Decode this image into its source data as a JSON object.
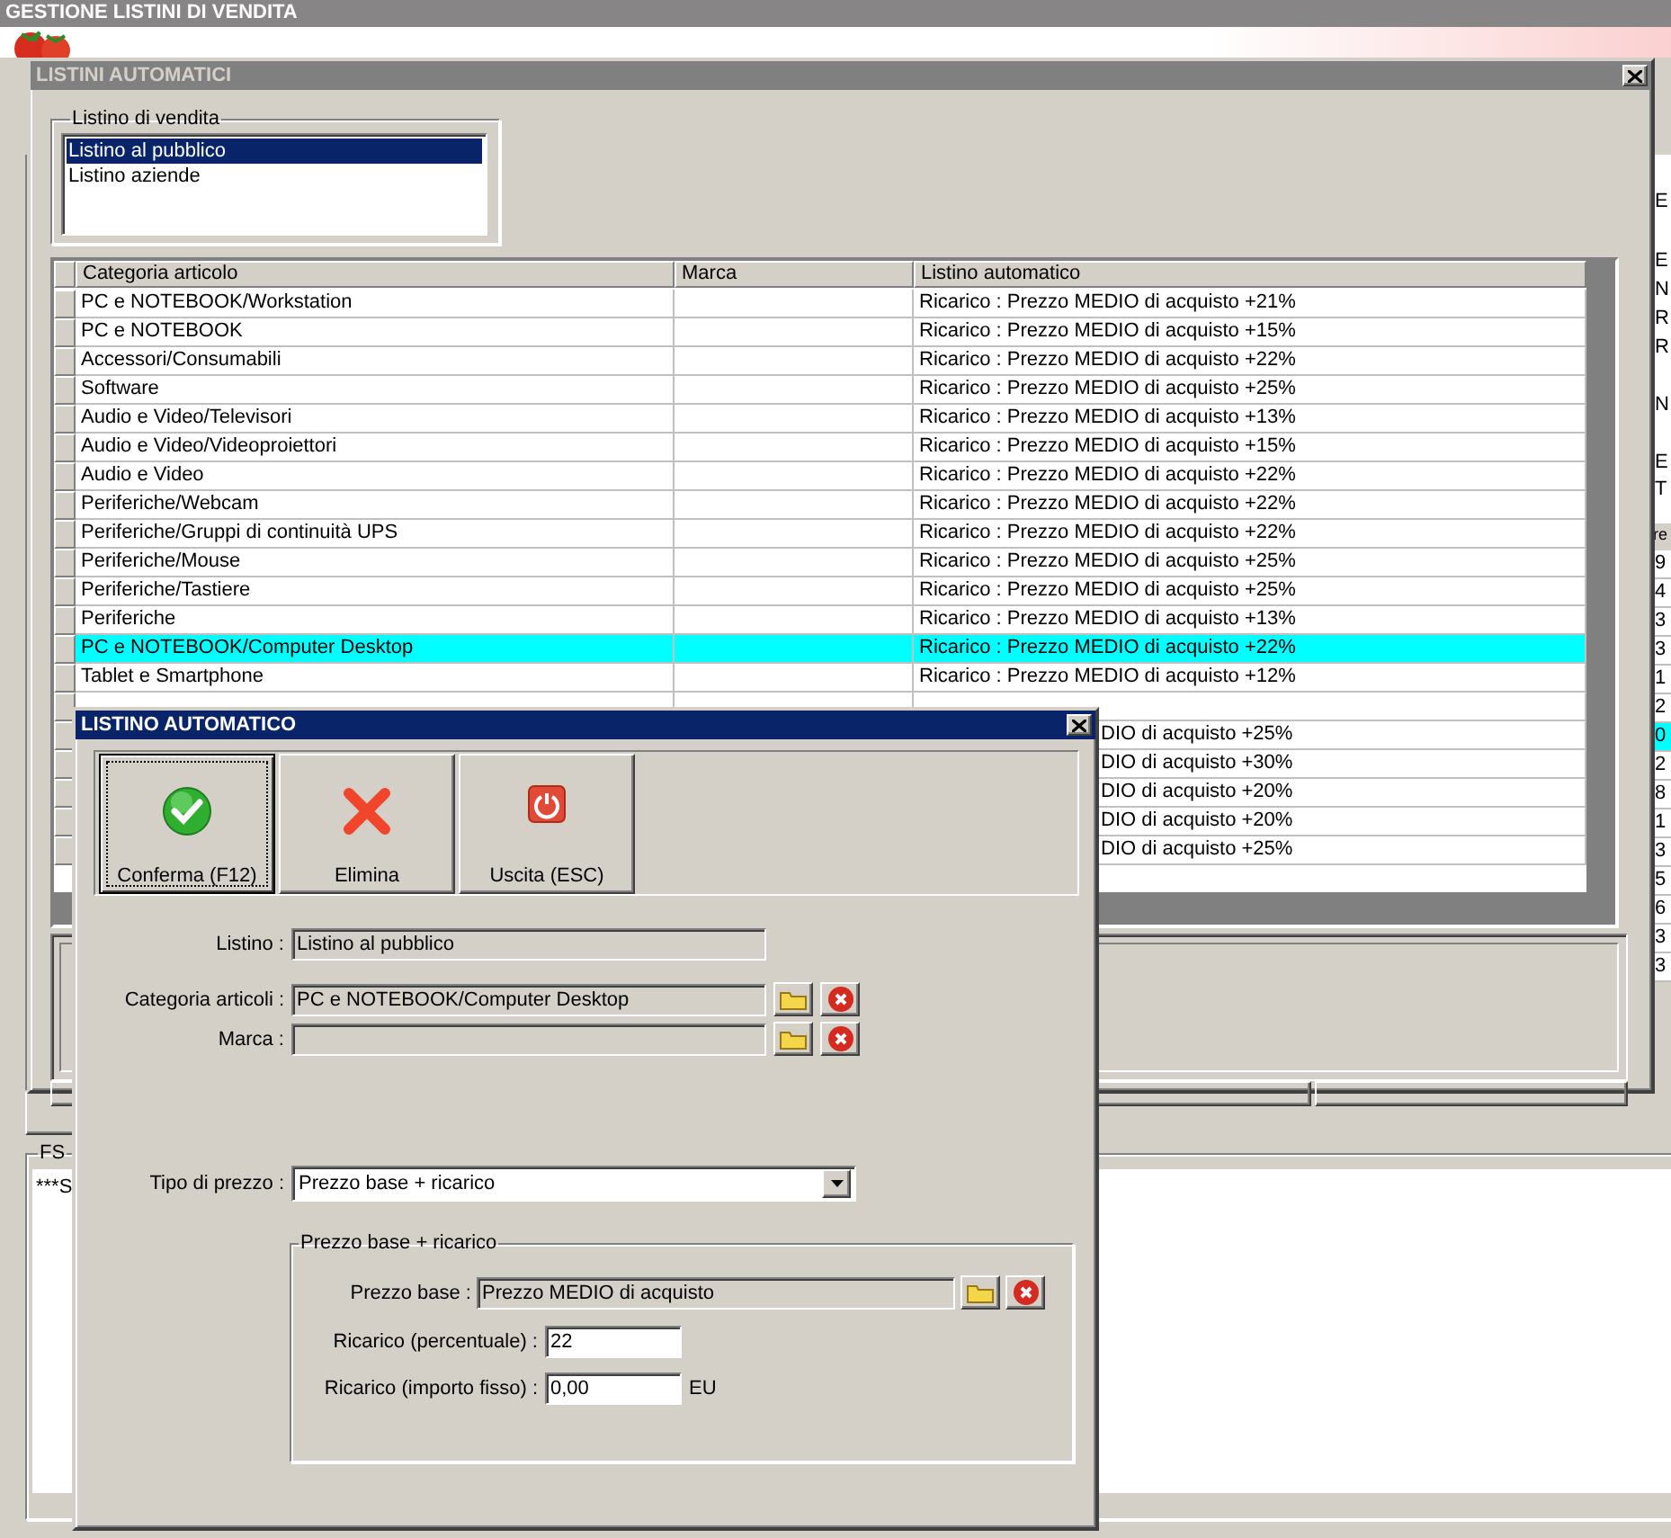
{
  "app": {
    "title": "GESTIONE LISTINI DI VENDITA",
    "edge_letters": [
      "E",
      "E",
      "N",
      "R",
      "R",
      "N",
      "E",
      "T"
    ],
    "edge_table": {
      "column_1": "re",
      "rows": [
        {
          "text": "9",
          "selected": false
        },
        {
          "text": "4",
          "selected": false
        },
        {
          "text": "3",
          "selected": false
        },
        {
          "text": "3",
          "selected": false
        },
        {
          "text": "1",
          "selected": false
        },
        {
          "text": "2",
          "selected": false
        },
        {
          "text": "0",
          "selected": true
        },
        {
          "text": "2",
          "selected": false
        },
        {
          "text": "8",
          "selected": false
        },
        {
          "text": "1",
          "selected": false
        },
        {
          "text": "3",
          "selected": false
        },
        {
          "text": "5",
          "selected": false
        },
        {
          "text": "6",
          "selected": false
        },
        {
          "text": "3",
          "selected": false
        },
        {
          "text": "3",
          "selected": false
        }
      ]
    },
    "log": {
      "label": "FS",
      "text": "***S"
    }
  },
  "listini_window": {
    "title": "LISTINI AUTOMATICI",
    "active": false,
    "sale_list": {
      "label": "Listino di vendita",
      "items": [
        {
          "label": "Listino al pubblico",
          "selected": true
        },
        {
          "label": "Listino aziende",
          "selected": false
        }
      ]
    },
    "table": {
      "columns": [
        "Categoria articolo",
        "Marca",
        "Listino automatico"
      ],
      "rows": [
        {
          "categoria": "PC e NOTEBOOK/Workstation",
          "listino": "Ricarico : Prezzo MEDIO di acquisto +21%",
          "selected": false
        },
        {
          "categoria": "PC e NOTEBOOK",
          "listino": "Ricarico : Prezzo MEDIO di acquisto +15%",
          "selected": false
        },
        {
          "categoria": "Accessori/Consumabili",
          "listino": "Ricarico : Prezzo MEDIO di acquisto +22%",
          "selected": false
        },
        {
          "categoria": "Software",
          "listino": "Ricarico : Prezzo MEDIO di acquisto +25%",
          "selected": false
        },
        {
          "categoria": "Audio e Video/Televisori",
          "listino": "Ricarico : Prezzo MEDIO di acquisto +13%",
          "selected": false
        },
        {
          "categoria": "Audio e Video/Videoproiettori",
          "listino": "Ricarico : Prezzo MEDIO di acquisto +15%",
          "selected": false
        },
        {
          "categoria": "Audio e Video",
          "listino": "Ricarico : Prezzo MEDIO di acquisto +22%",
          "selected": false
        },
        {
          "categoria": "Periferiche/Webcam",
          "listino": "Ricarico : Prezzo MEDIO di acquisto +22%",
          "selected": false
        },
        {
          "categoria": "Periferiche/Gruppi di continuità UPS",
          "listino": "Ricarico : Prezzo MEDIO di acquisto +22%",
          "selected": false
        },
        {
          "categoria": "Periferiche/Mouse",
          "listino": "Ricarico : Prezzo MEDIO di acquisto +25%",
          "selected": false
        },
        {
          "categoria": "Periferiche/Tastiere",
          "listino": "Ricarico : Prezzo MEDIO di acquisto +25%",
          "selected": false
        },
        {
          "categoria": "Periferiche",
          "listino": "Ricarico : Prezzo MEDIO di acquisto +13%",
          "selected": false
        },
        {
          "categoria": "PC e NOTEBOOK/Computer Desktop",
          "listino": "Ricarico : Prezzo MEDIO di acquisto +22%",
          "selected": true
        },
        {
          "categoria": "Tablet e Smartphone",
          "listino": "Ricarico : Prezzo MEDIO di acquisto +12%",
          "selected": false
        },
        {
          "selected": false
        },
        {
          "listino": "DIO di acquisto +25%",
          "selected": false
        },
        {
          "listino": "DIO di acquisto +30%",
          "selected": false
        },
        {
          "listino": "DIO di acquisto +20%",
          "selected": false
        },
        {
          "listino": "DIO di acquisto +20%",
          "selected": false
        },
        {
          "listino": "DIO di acquisto +25%",
          "selected": false
        }
      ]
    }
  },
  "dialog": {
    "title": "LISTINO AUTOMATICO",
    "active": true,
    "buttons": [
      {
        "kind": "confirm",
        "label": "Conferma (F12)",
        "focused": true
      },
      {
        "kind": "delete",
        "label": "Elimina",
        "focused": false
      },
      {
        "kind": "exit",
        "label": "Uscita (ESC)",
        "focused": false
      }
    ],
    "fields": {
      "listino": {
        "label": "Listino :",
        "value": "Listino al pubblico"
      },
      "categoria": {
        "label": "Categoria articoli :",
        "value": "PC e NOTEBOOK/Computer Desktop"
      },
      "marca": {
        "label": "Marca :"
      },
      "tipo_prezzo": {
        "label": "Tipo di prezzo :",
        "value": "Prezzo base + ricarico"
      }
    },
    "price_group": {
      "label": "Prezzo base + ricarico",
      "prezzo_base": {
        "label": "Prezzo base :",
        "value": "Prezzo MEDIO di acquisto"
      },
      "ricarico_percentuale": {
        "label": "Ricarico (percentuale) :",
        "value": "22"
      },
      "ricarico_fisso": {
        "label": "Ricarico (importo fisso) :",
        "value": "0,00",
        "unit": "EU"
      }
    }
  }
}
